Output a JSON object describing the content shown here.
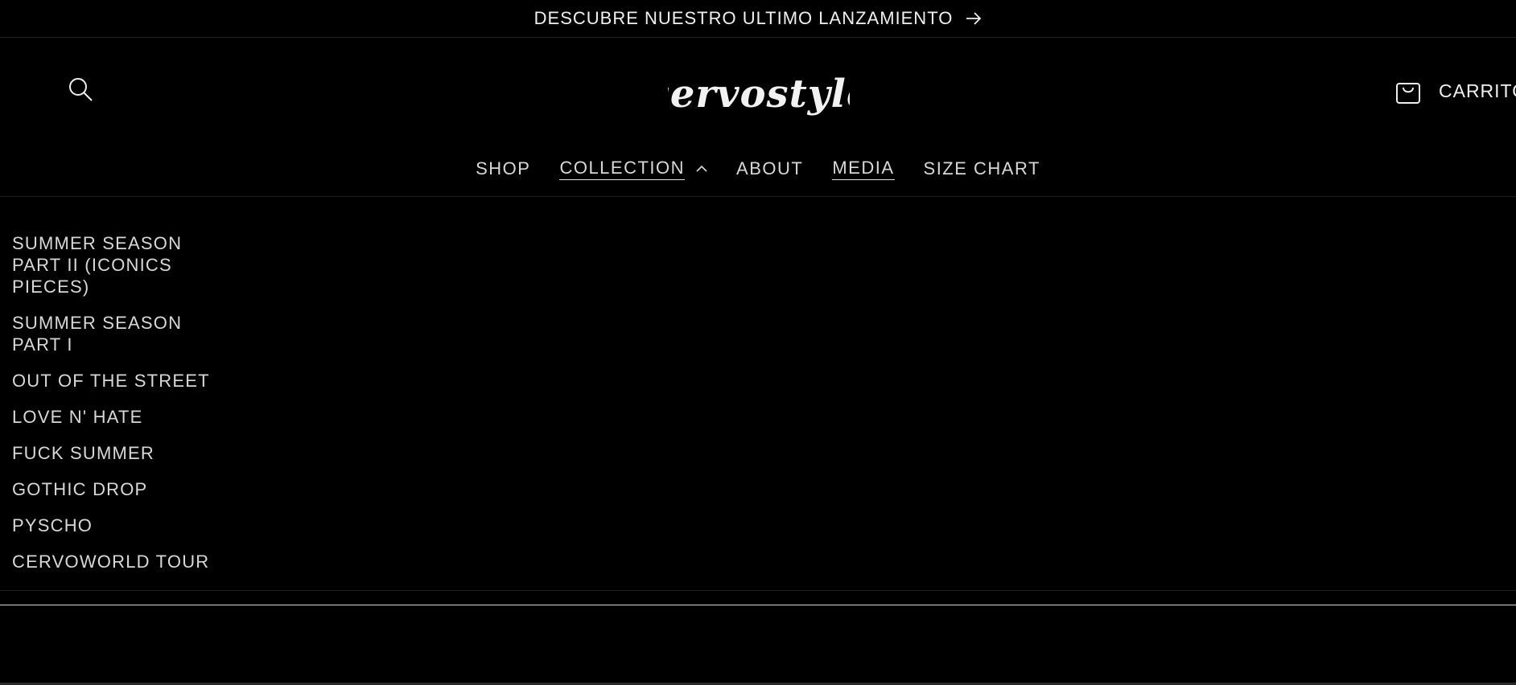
{
  "announcement": {
    "text": "DESCUBRE NUESTRO ULTIMO LANZAMIENTO",
    "arrow_icon": "arrow-right-icon"
  },
  "header": {
    "search_icon": "search-icon",
    "logo_text": "cervostyle",
    "cart": {
      "icon": "shopping-bag-icon",
      "label": "CARRITO"
    }
  },
  "nav": {
    "items": [
      {
        "label": "SHOP"
      },
      {
        "label": "COLLECTION",
        "icon": "chevron-up-icon"
      },
      {
        "label": "ABOUT"
      },
      {
        "label": "MEDIA"
      },
      {
        "label": "SIZE CHART"
      }
    ]
  },
  "dropdown": {
    "items": [
      {
        "label": "SUMMER SEASON PART II (ICONICS PIECES)"
      },
      {
        "label": "SUMMER SEASON PART I"
      },
      {
        "label": "OUT OF THE STREET"
      },
      {
        "label": "LOVE N' HATE"
      },
      {
        "label": "FUCK SUMMER"
      },
      {
        "label": "GOTHIC DROP"
      },
      {
        "label": "PYSCHO"
      },
      {
        "label": "CERVOWORLD TOUR"
      }
    ]
  },
  "colors": {
    "background": "#000000",
    "text": "#e6e6e6",
    "divider": "#1c1c1c"
  }
}
